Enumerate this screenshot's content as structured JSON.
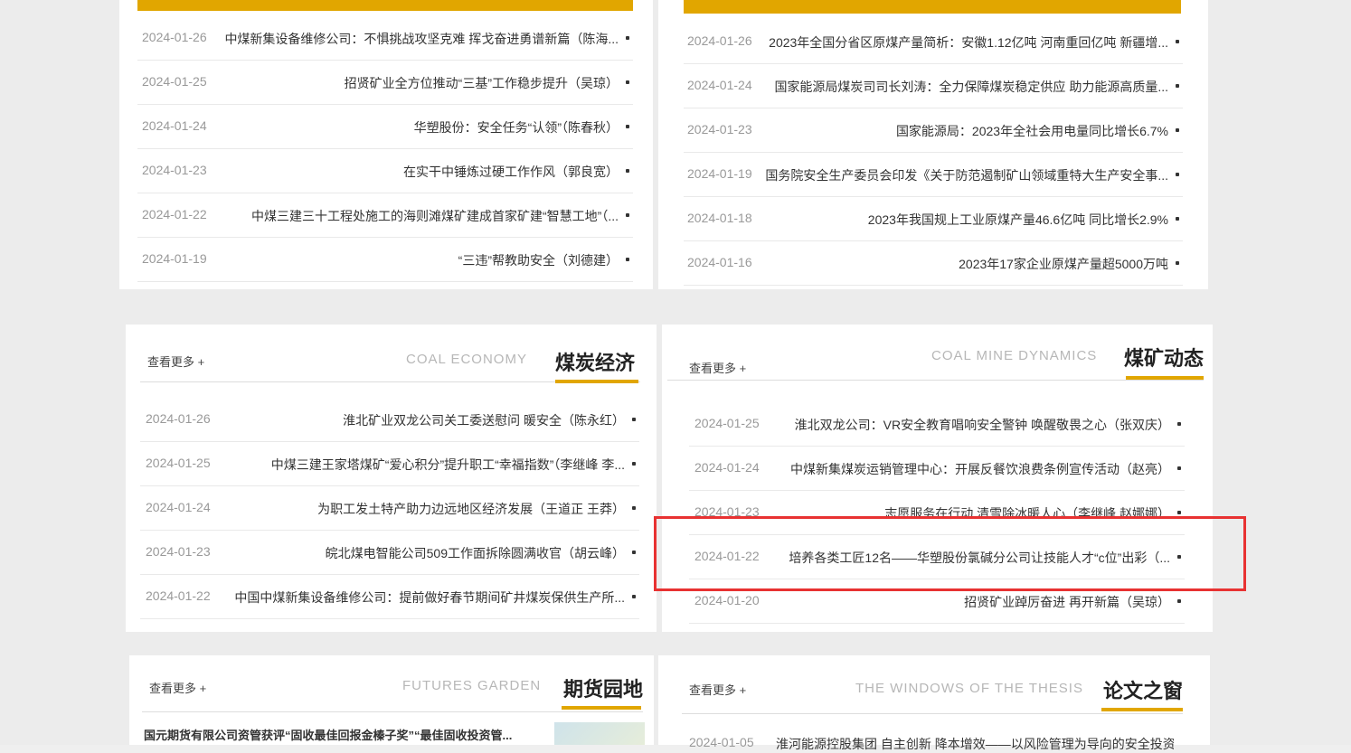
{
  "panels": {
    "top_left": {
      "rows": [
        {
          "title": "中煤新集设备维修公司：不惧挑战攻坚克难 挥戈奋进勇谱新篇（陈海...",
          "date": "2024-01-26"
        },
        {
          "title": "招贤矿业全方位推动“三基”工作稳步提升（吴琼）",
          "date": "2024-01-25"
        },
        {
          "title": "华塑股份：安全任务“认领”（陈春秋）",
          "date": "2024-01-24"
        },
        {
          "title": "在实干中锤炼过硬工作作风（郭良宽）",
          "date": "2024-01-23"
        },
        {
          "title": "中煤三建三十工程处施工的海则滩煤矿建成首家矿建“智慧工地”（...",
          "date": "2024-01-22"
        },
        {
          "title": "“三违”帮教助安全（刘德建）",
          "date": "2024-01-19"
        }
      ]
    },
    "top_right": {
      "rows": [
        {
          "title": "2023年全国分省区原煤产量简析：安徽1.12亿吨 河南重回亿吨 新疆增...",
          "date": "2024-01-26"
        },
        {
          "title": "国家能源局煤炭司司长刘涛：全力保障煤炭稳定供应 助力能源高质量...",
          "date": "2024-01-24"
        },
        {
          "title": "国家能源局：2023年全社会用电量同比增长6.7%",
          "date": "2024-01-23"
        },
        {
          "title": "国务院安全生产委员会印发《关于防范遏制矿山领域重特大生产安全事...",
          "date": "2024-01-19"
        },
        {
          "title": "2023年我国规上工业原煤产量46.6亿吨 同比增长2.9%",
          "date": "2024-01-18"
        },
        {
          "title": "2023年17家企业原煤产量超5000万吨",
          "date": "2024-01-16"
        }
      ]
    },
    "coal_economy": {
      "title": "煤炭经济",
      "en": "COAL ECONOMY",
      "more": "查看更多 +",
      "rows": [
        {
          "title": "淮北矿业双龙公司关工委送慰问 暖安全（陈永红）",
          "date": "2024-01-26"
        },
        {
          "title": "中煤三建王家塔煤矿“爱心积分”提升职工“幸福指数”（李继峰 李...",
          "date": "2024-01-25"
        },
        {
          "title": "为职工发土特产助力边远地区经济发展（王道正 王莽）",
          "date": "2024-01-24"
        },
        {
          "title": "皖北煤电智能公司509工作面拆除圆满收官（胡云峰）",
          "date": "2024-01-23"
        },
        {
          "title": "中国中煤新集设备维修公司：提前做好春节期间矿井煤炭保供生产所...",
          "date": "2024-01-22"
        }
      ]
    },
    "coal_mine_dynamics": {
      "title": "煤矿动态",
      "en": "COAL MINE DYNAMICS",
      "more": "查看更多 +",
      "rows": [
        {
          "title": "淮北双龙公司：VR安全教育唱响安全警钟 唤醒敬畏之心（张双庆）",
          "date": "2024-01-25"
        },
        {
          "title": "中煤新集煤炭运销管理中心：开展反餐饮浪费条例宣传活动（赵亮）",
          "date": "2024-01-24"
        },
        {
          "title": "志愿服务在行动 清雪除冰暖人心（李继峰 赵娜娜）",
          "date": "2024-01-23"
        },
        {
          "title": "培养各类工匠12名——华塑股份氯碱分公司让技能人才“c位”出彩（...",
          "date": "2024-01-22"
        },
        {
          "title": "招贤矿业踔厉奋进 再开新篇（吴琼）",
          "date": "2024-01-20"
        }
      ]
    },
    "futures_garden": {
      "title": "期货园地",
      "en": "FUTURES GARDEN",
      "more": "查看更多 +",
      "rows": [
        {
          "title": "国元期货有限公司资管获评“固收最佳回报金榛子奖”“最佳固收投资管...",
          "date": ""
        }
      ]
    },
    "thesis": {
      "title": "论文之窗",
      "en": "THE WINDOWS OF THE THESIS",
      "more": "查看更多 +",
      "rows": [
        {
          "title": "淮河能源控股集团 自主创新 降本增效——以风险管理为导向的安全投资创...",
          "date": "2024-01-05"
        }
      ]
    }
  }
}
